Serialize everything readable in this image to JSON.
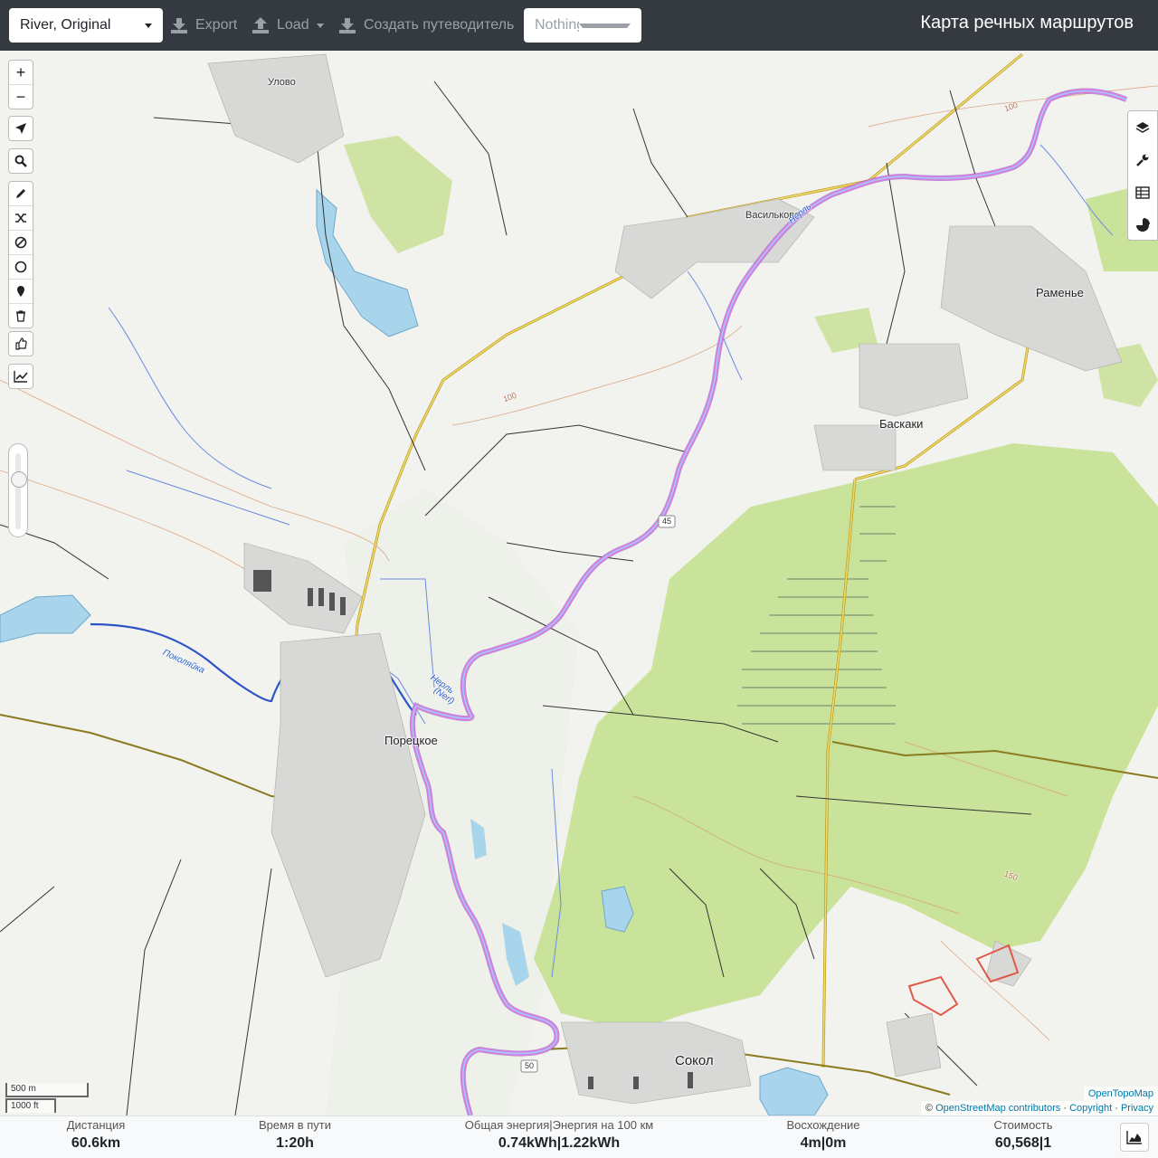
{
  "topbar": {
    "profile": "River, Original",
    "export_label": "Export",
    "load_label": "Load",
    "guide_label": "Создать путеводитель",
    "selection_placeholder": "Nothing selected",
    "app_title": "Карта речных маршрутов"
  },
  "map": {
    "places": {
      "ulovo": "Улово",
      "vasilkovo": "Васильково",
      "ramenye": "Раменье",
      "baskaki": "Баскаки",
      "poretskoe": "Порецкое",
      "sokol": "Сокол"
    },
    "rivers": {
      "nerl_1": "Нерль",
      "nerl_2": "(Nerl)",
      "pokolyaika": "Поколяйка"
    },
    "contours": {
      "c100": "100",
      "c150": "150"
    },
    "road_refs": {
      "r45": "45",
      "r50": "50"
    },
    "route_color": "#d67fe8",
    "scale": {
      "metric": "500 m",
      "imperial": "1000 ft"
    },
    "attribution": {
      "opentopomap": "OpenTopoMap",
      "prefix": "©",
      "osm": "OpenStreetMap contributors",
      "sep1": "·",
      "copyright": "Copyright",
      "sep2": "·",
      "privacy": "Privacy"
    },
    "controls_left": [
      "plus-icon",
      "minus-icon",
      "locate-icon",
      "search-icon",
      "pencil-icon",
      "shuffle-icon",
      "no-entry-icon",
      "circle-icon",
      "marker-icon",
      "trash-icon",
      "thumbs-up-icon",
      "chart-icon"
    ],
    "controls_right": [
      "layers-icon",
      "wrench-icon",
      "table-icon",
      "pie-chart-icon"
    ]
  },
  "stats": {
    "distance": {
      "label": "Дистанция",
      "value": "60.6",
      "unit": "km"
    },
    "time": {
      "label": "Время в пути",
      "value": "1:20",
      "unit": "h"
    },
    "energy": {
      "label_a": "Общая энергия",
      "label_b": "Энергия на 100 км",
      "value_a": "0.74",
      "unit_a": "kWh",
      "value_b": "1.22",
      "unit_b": "kWh"
    },
    "ascent": {
      "label": "Восхождение",
      "value_a": "4",
      "unit_a": "m",
      "value_b": "0",
      "unit_b": "m"
    },
    "cost": {
      "label": "Стоимость",
      "value_a": "60,568",
      "value_b": "1"
    }
  }
}
